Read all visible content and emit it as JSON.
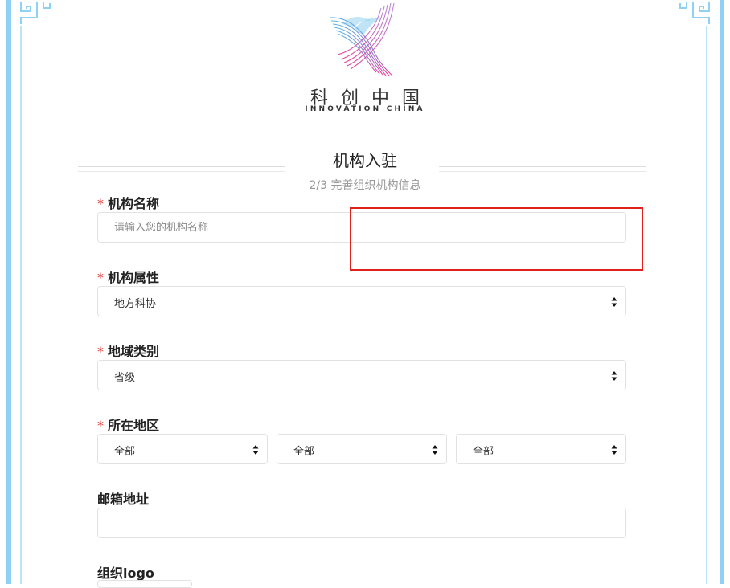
{
  "brand": {
    "name_cn": "科创中国",
    "name_en": "INNOVATION CHINA"
  },
  "header": {
    "title": "机构入驻",
    "step": "2/3 完善组织机构信息"
  },
  "form": {
    "required_mark": "*",
    "org_name": {
      "label": "机构名称",
      "placeholder": "请输入您的机构名称",
      "value": ""
    },
    "org_type": {
      "label": "机构属性",
      "selected": "地方科协"
    },
    "region_type": {
      "label": "地域类别",
      "selected": "省级"
    },
    "location": {
      "label": "所在地区",
      "selects": [
        "全部",
        "全部",
        "全部"
      ]
    },
    "email": {
      "label": "邮箱地址",
      "value": ""
    },
    "logo": {
      "label": "组织logo"
    }
  },
  "colors": {
    "border_accent": "#8fd0f5",
    "required": "#e0403c",
    "highlight": "#e0201c"
  }
}
